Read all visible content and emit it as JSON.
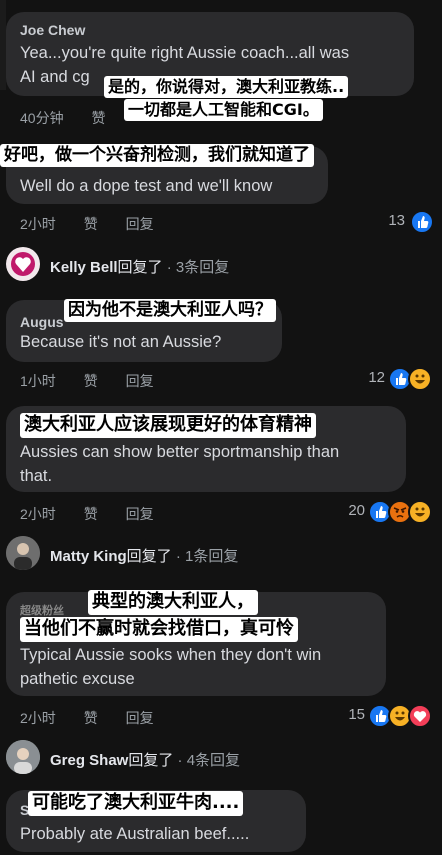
{
  "comments": [
    {
      "name": "Joe Chew",
      "text": "Yea...you're quite right Aussie coach...all was",
      "text2": "AI and cg",
      "time": "40分钟",
      "like": "赞"
    },
    {
      "text": "Well do a dope test and we'll know",
      "time": "2小时",
      "like": "赞",
      "reply": "回复",
      "count": "13"
    },
    {
      "name": "Augus",
      "text": "Because it's not an Aussie?",
      "time": "1小时",
      "like": "赞",
      "reply": "回复",
      "count": "12"
    },
    {
      "text": "Aussies can show better sportmanship than",
      "text2": "that.",
      "time": "2小时",
      "like": "赞",
      "reply": "回复",
      "count": "20"
    },
    {
      "name": "超级粉丝",
      "text": "Typical Aussie sooks when they don't win",
      "text2": "pathetic excuse",
      "time": "2小时",
      "like": "赞",
      "reply": "回复",
      "count": "15"
    },
    {
      "name": "S",
      "text": "Probably ate Australian beef....."
    }
  ],
  "replies": [
    {
      "name": "Kelly Bell",
      "action": "回复了",
      "sep": "·",
      "count": "3条回复"
    },
    {
      "name": "Matty King",
      "action": "回复了",
      "sep": "·",
      "count": "1条回复"
    },
    {
      "name": "Greg Shaw",
      "action": "回复了",
      "sep": "·",
      "count": "4条回复"
    }
  ],
  "overlays": {
    "o1a": "是的，你说得对，澳大利亚教练..",
    "o1b": "一切都是人工智能和CGI。",
    "o2": "好吧，做一个兴奋剂检测，我们就知道了",
    "o3": "因为他不是澳大利亚人吗？",
    "o4": "澳大利亚人应该展现更好的体育精神",
    "o5a": "典型的澳大利亚人，",
    "o5b": "当他们不赢时就会找借口，真可怜",
    "o6": "可能吃了澳大利亚牛肉...."
  },
  "icons": {
    "like": "like-reaction-icon",
    "haha": "haha-reaction-icon",
    "angry": "angry-reaction-icon",
    "love": "love-reaction-icon"
  },
  "colors": {
    "background": "#121212",
    "bubble": "#2b2b2d",
    "like": "#1877f2"
  }
}
